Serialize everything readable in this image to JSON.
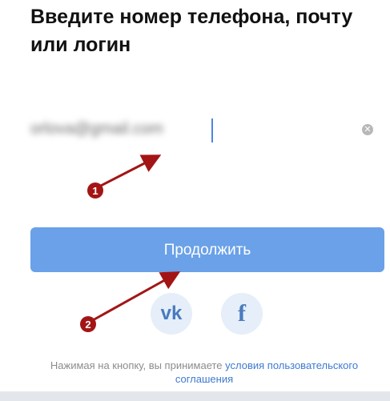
{
  "page": {
    "title": "Введите номер телефона, почту или логин"
  },
  "login_field": {
    "value": "orlova@gmail.com",
    "clear_icon": "clear-circle-icon"
  },
  "continue_button": {
    "label": "Продолжить"
  },
  "social": {
    "vk_label": "vk",
    "fb_label": "f"
  },
  "legal": {
    "text": "Нажимая на кнопку, вы принимаете ",
    "link": "условия пользовательского соглашения"
  },
  "annotations": {
    "marker_1": "1",
    "marker_2": "2"
  },
  "colors": {
    "accent": "#6aa1e8",
    "link": "#3e7ad1",
    "annotation": "#a31515"
  }
}
